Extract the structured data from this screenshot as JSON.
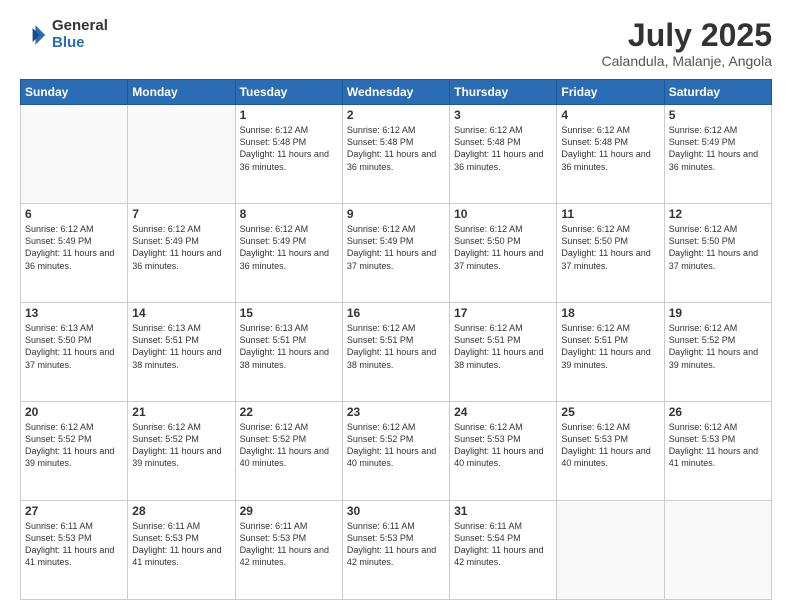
{
  "logo": {
    "general": "General",
    "blue": "Blue"
  },
  "header": {
    "month": "July 2025",
    "location": "Calandula, Malanje, Angola"
  },
  "weekdays": [
    "Sunday",
    "Monday",
    "Tuesday",
    "Wednesday",
    "Thursday",
    "Friday",
    "Saturday"
  ],
  "weeks": [
    [
      {
        "day": "",
        "info": ""
      },
      {
        "day": "",
        "info": ""
      },
      {
        "day": "1",
        "info": "Sunrise: 6:12 AM\nSunset: 5:48 PM\nDaylight: 11 hours and 36 minutes."
      },
      {
        "day": "2",
        "info": "Sunrise: 6:12 AM\nSunset: 5:48 PM\nDaylight: 11 hours and 36 minutes."
      },
      {
        "day": "3",
        "info": "Sunrise: 6:12 AM\nSunset: 5:48 PM\nDaylight: 11 hours and 36 minutes."
      },
      {
        "day": "4",
        "info": "Sunrise: 6:12 AM\nSunset: 5:48 PM\nDaylight: 11 hours and 36 minutes."
      },
      {
        "day": "5",
        "info": "Sunrise: 6:12 AM\nSunset: 5:49 PM\nDaylight: 11 hours and 36 minutes."
      }
    ],
    [
      {
        "day": "6",
        "info": "Sunrise: 6:12 AM\nSunset: 5:49 PM\nDaylight: 11 hours and 36 minutes."
      },
      {
        "day": "7",
        "info": "Sunrise: 6:12 AM\nSunset: 5:49 PM\nDaylight: 11 hours and 36 minutes."
      },
      {
        "day": "8",
        "info": "Sunrise: 6:12 AM\nSunset: 5:49 PM\nDaylight: 11 hours and 36 minutes."
      },
      {
        "day": "9",
        "info": "Sunrise: 6:12 AM\nSunset: 5:49 PM\nDaylight: 11 hours and 37 minutes."
      },
      {
        "day": "10",
        "info": "Sunrise: 6:12 AM\nSunset: 5:50 PM\nDaylight: 11 hours and 37 minutes."
      },
      {
        "day": "11",
        "info": "Sunrise: 6:12 AM\nSunset: 5:50 PM\nDaylight: 11 hours and 37 minutes."
      },
      {
        "day": "12",
        "info": "Sunrise: 6:12 AM\nSunset: 5:50 PM\nDaylight: 11 hours and 37 minutes."
      }
    ],
    [
      {
        "day": "13",
        "info": "Sunrise: 6:13 AM\nSunset: 5:50 PM\nDaylight: 11 hours and 37 minutes."
      },
      {
        "day": "14",
        "info": "Sunrise: 6:13 AM\nSunset: 5:51 PM\nDaylight: 11 hours and 38 minutes."
      },
      {
        "day": "15",
        "info": "Sunrise: 6:13 AM\nSunset: 5:51 PM\nDaylight: 11 hours and 38 minutes."
      },
      {
        "day": "16",
        "info": "Sunrise: 6:12 AM\nSunset: 5:51 PM\nDaylight: 11 hours and 38 minutes."
      },
      {
        "day": "17",
        "info": "Sunrise: 6:12 AM\nSunset: 5:51 PM\nDaylight: 11 hours and 38 minutes."
      },
      {
        "day": "18",
        "info": "Sunrise: 6:12 AM\nSunset: 5:51 PM\nDaylight: 11 hours and 39 minutes."
      },
      {
        "day": "19",
        "info": "Sunrise: 6:12 AM\nSunset: 5:52 PM\nDaylight: 11 hours and 39 minutes."
      }
    ],
    [
      {
        "day": "20",
        "info": "Sunrise: 6:12 AM\nSunset: 5:52 PM\nDaylight: 11 hours and 39 minutes."
      },
      {
        "day": "21",
        "info": "Sunrise: 6:12 AM\nSunset: 5:52 PM\nDaylight: 11 hours and 39 minutes."
      },
      {
        "day": "22",
        "info": "Sunrise: 6:12 AM\nSunset: 5:52 PM\nDaylight: 11 hours and 40 minutes."
      },
      {
        "day": "23",
        "info": "Sunrise: 6:12 AM\nSunset: 5:52 PM\nDaylight: 11 hours and 40 minutes."
      },
      {
        "day": "24",
        "info": "Sunrise: 6:12 AM\nSunset: 5:53 PM\nDaylight: 11 hours and 40 minutes."
      },
      {
        "day": "25",
        "info": "Sunrise: 6:12 AM\nSunset: 5:53 PM\nDaylight: 11 hours and 40 minutes."
      },
      {
        "day": "26",
        "info": "Sunrise: 6:12 AM\nSunset: 5:53 PM\nDaylight: 11 hours and 41 minutes."
      }
    ],
    [
      {
        "day": "27",
        "info": "Sunrise: 6:11 AM\nSunset: 5:53 PM\nDaylight: 11 hours and 41 minutes."
      },
      {
        "day": "28",
        "info": "Sunrise: 6:11 AM\nSunset: 5:53 PM\nDaylight: 11 hours and 41 minutes."
      },
      {
        "day": "29",
        "info": "Sunrise: 6:11 AM\nSunset: 5:53 PM\nDaylight: 11 hours and 42 minutes."
      },
      {
        "day": "30",
        "info": "Sunrise: 6:11 AM\nSunset: 5:53 PM\nDaylight: 11 hours and 42 minutes."
      },
      {
        "day": "31",
        "info": "Sunrise: 6:11 AM\nSunset: 5:54 PM\nDaylight: 11 hours and 42 minutes."
      },
      {
        "day": "",
        "info": ""
      },
      {
        "day": "",
        "info": ""
      }
    ]
  ]
}
